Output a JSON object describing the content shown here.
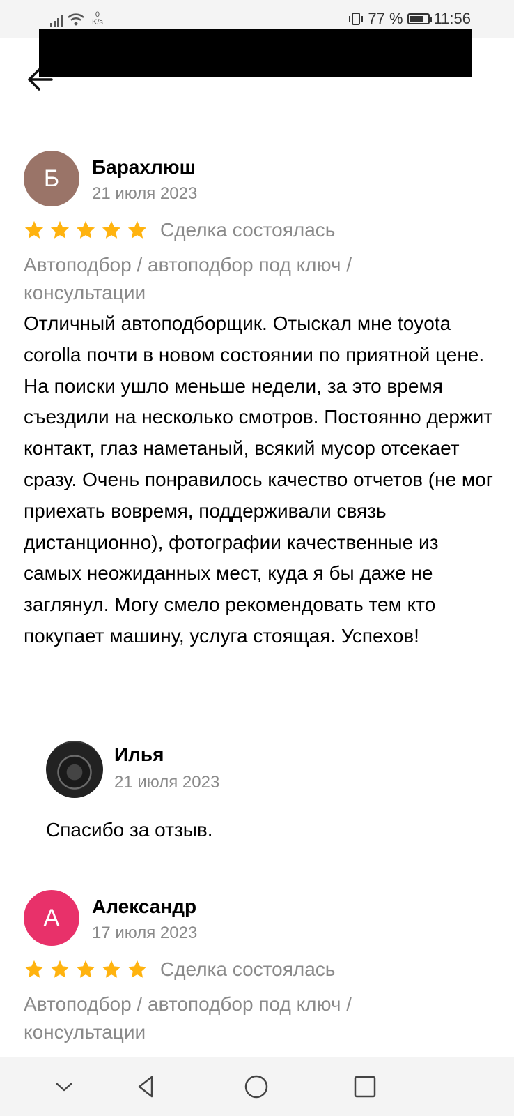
{
  "status_bar": {
    "net_speed_value": "0",
    "net_speed_unit": "K/s",
    "battery": "77 %",
    "battery_level": 0.77,
    "time": "11:56"
  },
  "reviews": [
    {
      "initial": "Б",
      "avatar_color": "#9a7468",
      "author": "Барахлюш",
      "date": "21 июля 2023",
      "rating": 5,
      "status": "Сделка состоялась",
      "category": "Автоподбор / автоподбор под ключ / консультации",
      "text": "Отличный автоподборщик. Отыскал мне toyota corolla почти в новом состоянии по приятной цене. На поиски ушло меньше недели, за это время съездили на несколько смотров. Постоянно держит контакт, глаз наметаный, всякий мусор отсекает сразу. Очень понравилось качество отчетов (не мог приехать вовремя, поддерживали связь дистанционно), фотографии качественные из самых неожиданных мест, куда я бы даже не заглянул. Могу смело рекомендовать тем кто покупает машину, услуга стоящая. Успехов!",
      "reply": {
        "author": "Илья",
        "date": "21 июля 2023",
        "text": "Спасибо за отзыв."
      }
    },
    {
      "initial": "А",
      "avatar_color": "#e8316a",
      "author": "Александр",
      "date": "17 июля 2023",
      "rating": 5,
      "status": "Сделка состоялась",
      "category": "Автоподбор / автоподбор под ключ / консультации"
    }
  ],
  "colors": {
    "star": "#ffb30f",
    "muted_text": "#8a8a8a"
  },
  "icons": [
    "back-arrow-icon",
    "nav-collapse-icon",
    "nav-back-icon",
    "nav-home-icon",
    "nav-recents-icon"
  ]
}
